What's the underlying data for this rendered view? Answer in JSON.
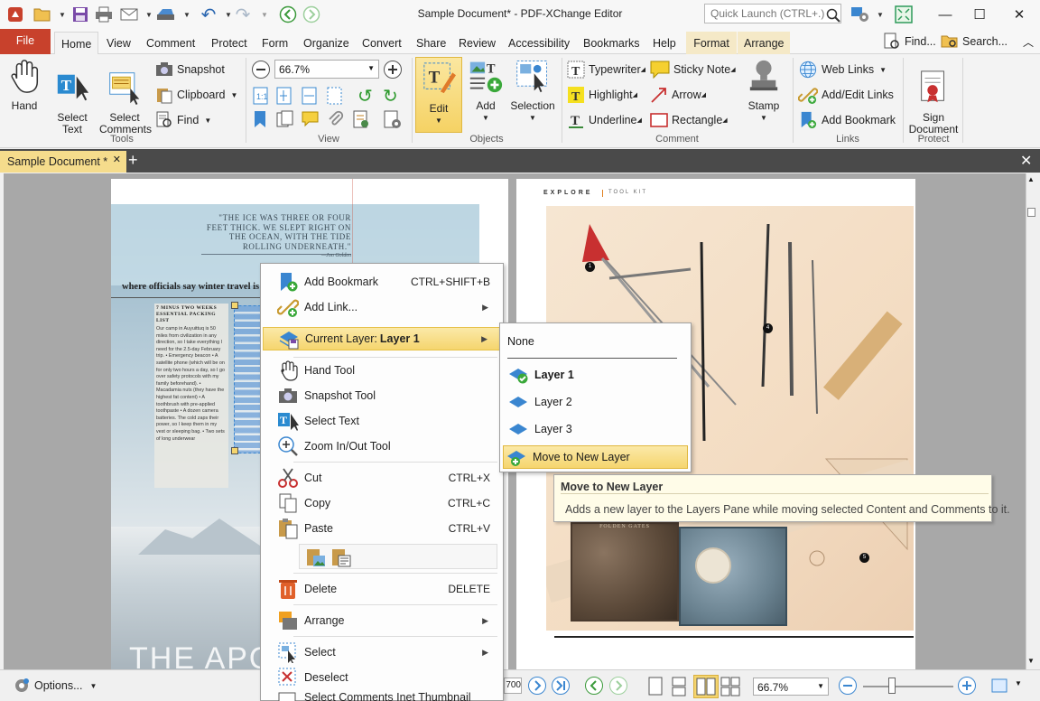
{
  "window": {
    "title": "Sample Document* - PDF-XChange Editor",
    "quick_launch_placeholder": "Quick Launch (CTRL+.)"
  },
  "ribbon_tabs": [
    "File",
    "Home",
    "View",
    "Comment",
    "Protect",
    "Form",
    "Organize",
    "Convert",
    "Share",
    "Review",
    "Accessibility",
    "Bookmarks",
    "Help",
    "Format",
    "Arrange"
  ],
  "ribbon_right": {
    "find": "Find...",
    "search": "Search..."
  },
  "groups": {
    "tools": {
      "label": "Tools",
      "hand": "Hand",
      "select_text": "Select\nText",
      "select_comments": "Select\nComments",
      "snapshot": "Snapshot",
      "clipboard": "Clipboard",
      "find": "Find"
    },
    "view": {
      "label": "View",
      "zoom": "66.7%"
    },
    "objects": {
      "label": "Objects",
      "edit": "Edit",
      "add": "Add",
      "selection": "Selection"
    },
    "comment": {
      "label": "Comment",
      "typewriter": "Typewriter",
      "sticky_note": "Sticky Note",
      "highlight": "Highlight",
      "arrow": "Arrow",
      "underline": "Underline",
      "rectangle": "Rectangle",
      "stamp": "Stamp"
    },
    "links": {
      "label": "Links",
      "web_links": "Web Links",
      "add_edit_links": "Add/Edit Links",
      "add_bookmark": "Add Bookmark"
    },
    "protect": {
      "label": "Protect",
      "sign_document": "Sign\nDocument"
    }
  },
  "doc_tab": {
    "label": "Sample Document *"
  },
  "page_left": {
    "quote": "\"THE ICE WAS THREE OR FOUR FEET THICK. WE SLEPT RIGHT ON THE OCEAN, WITH THE TIDE ROLLING UNDERNEATH.\"",
    "quote_author": "—Jon Golden",
    "headline": "where officials say winter travel is",
    "sidebar_title": "7 MINUS TWO WEEKS ESSENTIAL PACKING LIST",
    "sidebar_text": "Our camp in Auyuittuq is 50 miles from civilization in any direction, so I take everything I need for the 2.5-day February trip. • Emergency beacon • A satellite phone (which will be on for only two hours a day, so I go over safety protocols with my family beforehand). • Macadamia nuts (they have the highest fat content) • A toothbrush with pre-applied toothpaste • A dozen camera batteries. The cold zaps their power, so I keep them in my vest or sleeping bag. • Two sets of long underwear",
    "bottom_text": "THE APOT"
  },
  "page_right": {
    "header_left": "EXPLORE",
    "header_right": "TOOL KIT",
    "callouts": [
      "1",
      "4",
      "3",
      "5"
    ],
    "book_label": "FOLDEN GATES"
  },
  "context_menu": {
    "items": [
      {
        "label": "Add Bookmark",
        "shortcut": "CTRL+SHIFT+B"
      },
      {
        "label": "Add Link...",
        "submenu": true
      },
      {
        "label_prefix": "Current Layer: ",
        "label_bold": "Layer 1",
        "submenu": true
      },
      {
        "label": "Hand Tool"
      },
      {
        "label": "Snapshot Tool"
      },
      {
        "label": "Select Text"
      },
      {
        "label": "Zoom In/Out Tool"
      },
      {
        "label": "Cut",
        "shortcut": "CTRL+X"
      },
      {
        "label": "Copy",
        "shortcut": "CTRL+C"
      },
      {
        "label": "Paste",
        "shortcut": "CTRL+V"
      },
      {
        "label": "Delete",
        "shortcut": "DELETE"
      },
      {
        "label": "Arrange",
        "submenu": true
      },
      {
        "label": "Select",
        "submenu": true
      },
      {
        "label": "Deselect"
      },
      {
        "label": "Select Comments Inet Thumbnail"
      }
    ]
  },
  "layer_submenu": {
    "none": "None",
    "layers": [
      "Layer 1",
      "Layer 2",
      "Layer 3"
    ],
    "current": "Layer 1",
    "move_to_new": "Move to New Layer"
  },
  "tooltip": {
    "title": "Move to New Layer",
    "body": "Adds a new layer to the Layers Pane while moving selected Content and Comments to it."
  },
  "status": {
    "options": "Options...",
    "page_total": "700",
    "zoom": "66.7%"
  },
  "colors": {
    "file_tab": "#c8412c",
    "highlight": "#f5d56e",
    "doc_tab": "#f5dc8c",
    "accent_blue": "#2a76c6"
  }
}
